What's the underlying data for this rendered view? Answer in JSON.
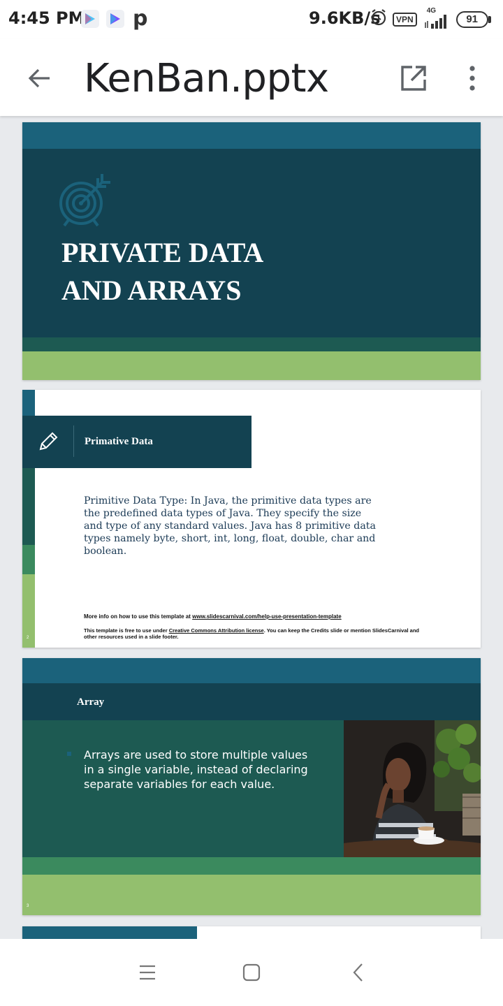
{
  "status_bar": {
    "time": "4:45 PM",
    "p_icon": "p",
    "network_speed": "9.6KB/s",
    "vpn": "VPN",
    "network_type": "4G",
    "battery": "91"
  },
  "app_bar": {
    "title": "KenBan.pptx"
  },
  "slides": {
    "s1": {
      "title_line1": "PRIVATE DATA",
      "title_line2": "AND ARRAYS"
    },
    "s2": {
      "header_title": "Primative Data",
      "body": "Primitive Data Type: In Java, the primitive data types are the predefined data types of Java. They specify the size and type of any standard values. Java has 8 primitive data types namely byte, short, int, long, float, double, char and boolean.",
      "more_info_prefix": "More info on how to use this template at ",
      "more_info_link": "www.slidescarnival.com/help-use-presentation-template",
      "license_prefix": "This template is free to use under ",
      "license_link": "Creative Commons Attribution license",
      "license_suffix": ". You can keep the Credits slide or mention SlidesCarnival and other resources used in a slide footer.",
      "page_number": "2"
    },
    "s3": {
      "header_title": "Array",
      "body": "Arrays are used to store multiple values in a single variable, instead of declaring separate variables for each value.",
      "page_number": "3"
    }
  },
  "colors": {
    "slide_navy": "#134251",
    "slide_teal_band": "#1b627b",
    "slide_green_dark": "#1d5a52",
    "slide_green_mid": "#3b8a5e",
    "slide_green_light": "#93bf6e",
    "page_background": "#e8eaed"
  },
  "icons": {
    "status_left": [
      "play-store-icon",
      "play-store-icon"
    ],
    "status_right": [
      "alarm-icon",
      "signal-icon",
      "battery-icon"
    ],
    "app_bar": [
      "back-arrow-icon",
      "open-external-icon",
      "more-vert-icon"
    ],
    "slides": [
      "target-icon",
      "pencil-icon"
    ],
    "nav": [
      "menu-icon",
      "home-icon",
      "back-icon"
    ]
  }
}
